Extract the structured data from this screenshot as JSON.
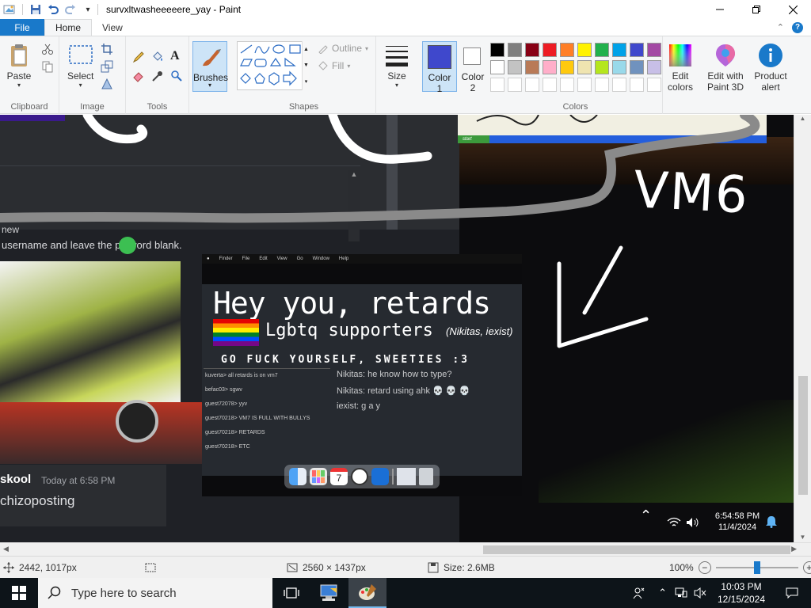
{
  "window": {
    "title": "survxltwasheeeeere_yay - Paint"
  },
  "tabs": {
    "file": "File",
    "home": "Home",
    "view": "View"
  },
  "ribbon": {
    "clipboard": {
      "label": "Clipboard",
      "paste": "Paste"
    },
    "image": {
      "label": "Image",
      "select": "Select"
    },
    "tools": {
      "label": "Tools"
    },
    "brushes": "Brushes",
    "shapes": {
      "label": "Shapes",
      "outline": "Outline",
      "fill": "Fill"
    },
    "size": "Size",
    "color1": {
      "line1": "Color",
      "line2": "1",
      "value": "#3f48cc"
    },
    "color2": {
      "line1": "Color",
      "line2": "2",
      "value": "#ffffff"
    },
    "colors": {
      "label": "Colors",
      "palette_row1": [
        "#000000",
        "#7f7f7f",
        "#880015",
        "#ed1c24",
        "#ff7f27",
        "#fff200",
        "#22b14c",
        "#00a2e8",
        "#3f48cc",
        "#a349a4"
      ],
      "palette_row2": [
        "#ffffff",
        "#c3c3c3",
        "#b97a57",
        "#ffaec9",
        "#ffc90e",
        "#efe4b0",
        "#b5e61d",
        "#99d9ea",
        "#7092be",
        "#c8bfe7"
      ]
    },
    "edit_colors": {
      "line1": "Edit",
      "line2": "colors"
    },
    "edit_paint3d": {
      "line1": "Edit with",
      "line2": "Paint 3D"
    },
    "product_alert": {
      "line1": "Product",
      "line2": "alert"
    }
  },
  "canvas_content": {
    "login_hint": "username and leave the pa   word blank.",
    "new_text": "new",
    "vm_label": "VM6",
    "inner": {
      "headline": "Hey you, retards",
      "subline": "Lgbtq supporters",
      "subline_names": "(Nikitas, iexist)",
      "taunt": "GO FUCK YOURSELF, SWEETIES :3",
      "chat_lines": [
        "kuverta> all retards is on vm7",
        "befac03> sgwv",
        "guest72078> yyv",
        "guest70218> VM7 IS FULL WITH BULLYS",
        "guest70218> RETARDS",
        "guest70218> ETC"
      ],
      "right_lines": [
        "Nikitas: he know how to type?",
        "Nikitas: retard using ahk 💀 💀 💀",
        "iexist: g a y"
      ],
      "mac_menu": [
        "Finder",
        "File",
        "Edit",
        "View",
        "Go",
        "Window",
        "Help"
      ],
      "calendar_day": "7"
    },
    "discord": {
      "user": "skool",
      "time": "Today at 6:58 PM",
      "message": "chizoposting"
    },
    "vm_clock": {
      "time": "6:54:58 PM",
      "date": "11/4/2024"
    },
    "xp_start": "start"
  },
  "status": {
    "cursor_pos": "2442, 1017px",
    "image_size": "2560 × 1437px",
    "file_size": "Size: 2.6MB",
    "zoom": "100%",
    "zoom_fraction": 0.5
  },
  "taskbar": {
    "search_placeholder": "Type here to search",
    "time": "10:03 PM",
    "date": "12/15/2024"
  }
}
